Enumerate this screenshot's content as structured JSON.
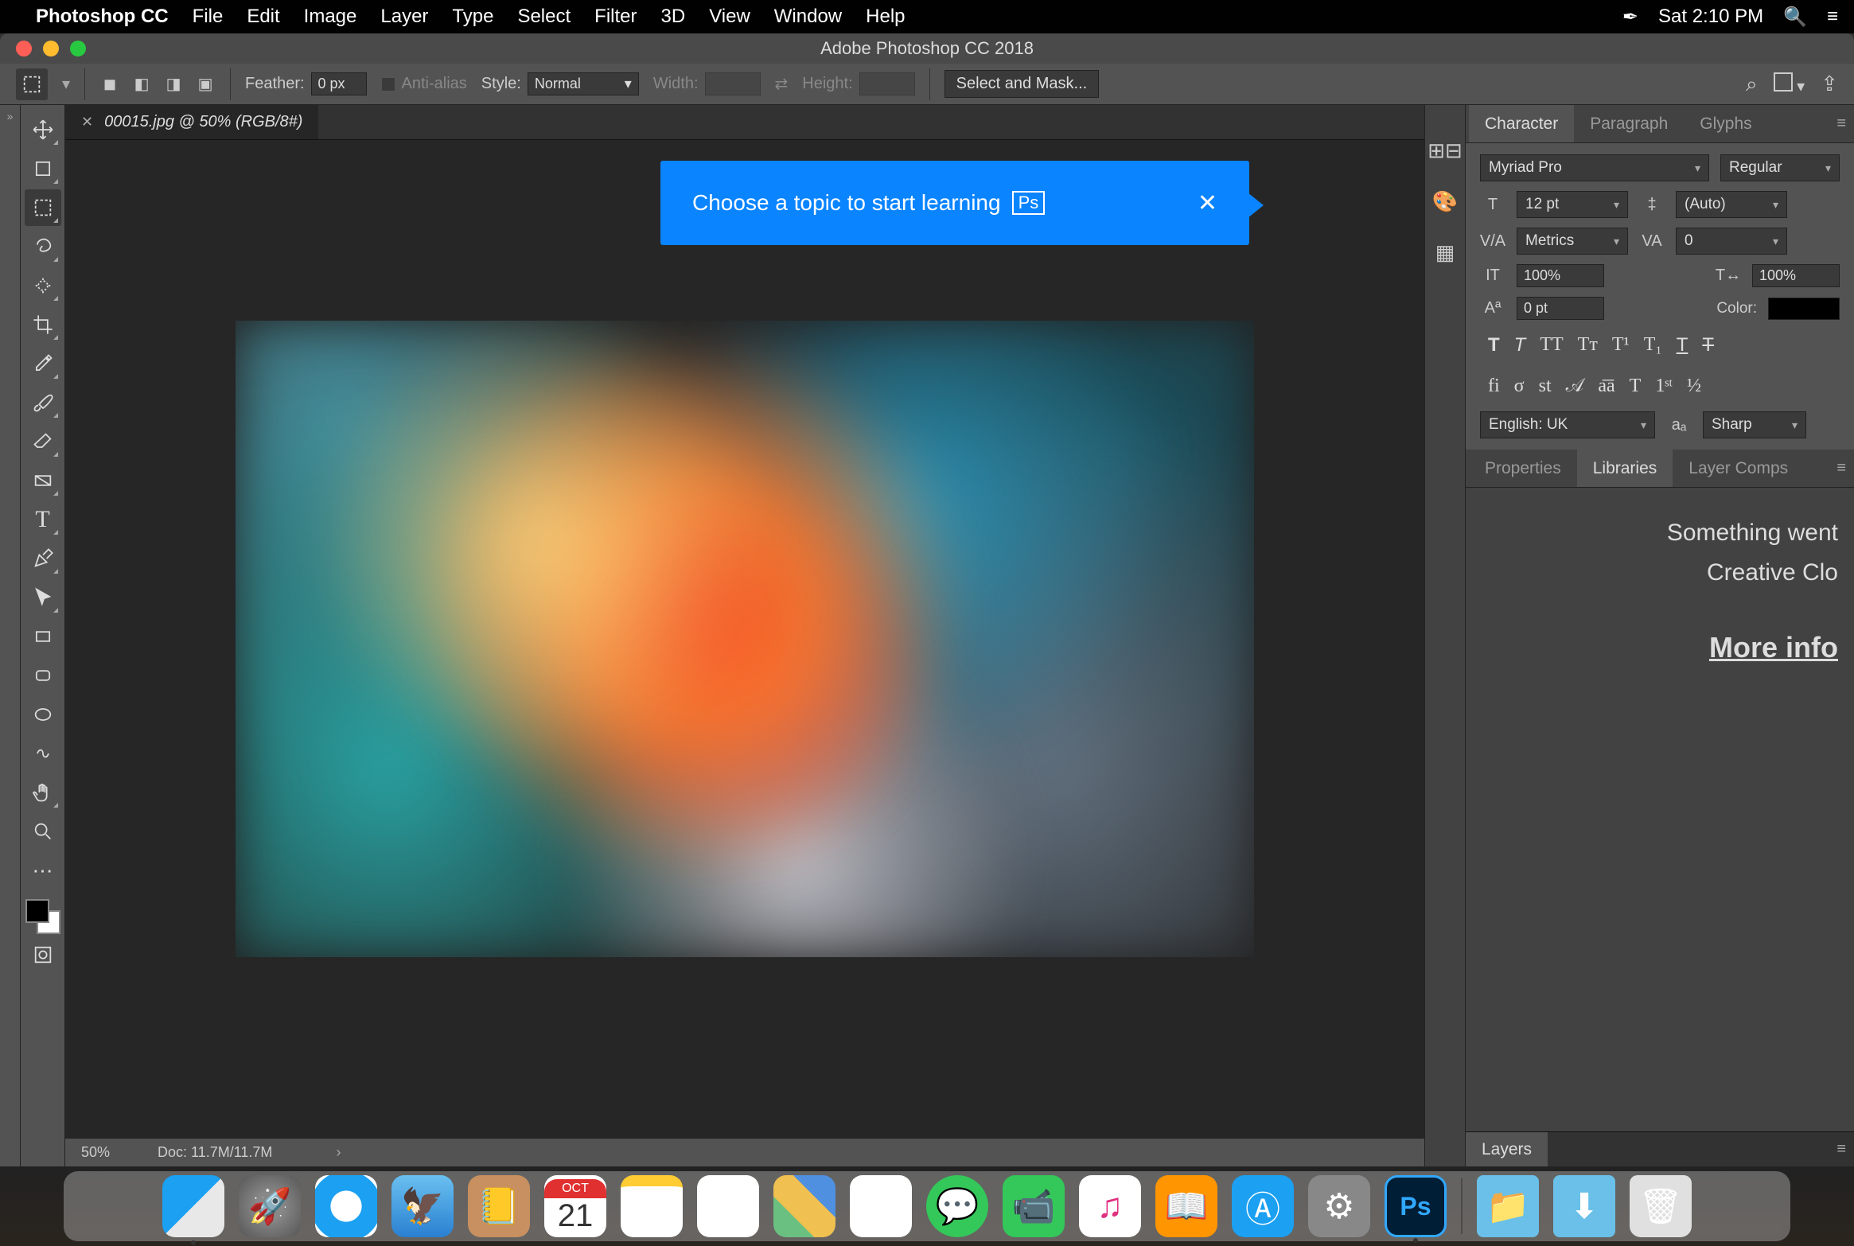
{
  "menubar": {
    "app": "Photoshop CC",
    "items": [
      "File",
      "Edit",
      "Image",
      "Layer",
      "Type",
      "Select",
      "Filter",
      "3D",
      "View",
      "Window",
      "Help"
    ],
    "clock": "Sat 2:10 PM"
  },
  "window": {
    "title": "Adobe Photoshop CC 2018"
  },
  "options": {
    "feather_label": "Feather:",
    "feather_value": "0 px",
    "antialias_label": "Anti-alias",
    "style_label": "Style:",
    "style_value": "Normal",
    "width_label": "Width:",
    "width_value": "",
    "height_label": "Height:",
    "height_value": "",
    "select_mask": "Select and Mask..."
  },
  "tab": {
    "label": "00015.jpg @ 50% (RGB/8#)"
  },
  "tooltip": {
    "text": "Choose a topic to start learning",
    "badge": "Ps"
  },
  "status": {
    "zoom": "50%",
    "doc": "Doc: 11.7M/11.7M"
  },
  "char_panel": {
    "tabs": [
      "Character",
      "Paragraph",
      "Glyphs"
    ],
    "font": "Myriad Pro",
    "weight": "Regular",
    "size": "12 pt",
    "leading": "(Auto)",
    "kerning": "Metrics",
    "tracking": "0",
    "vscale": "100%",
    "hscale": "100%",
    "baseline": "0 pt",
    "color_label": "Color:",
    "lang": "English: UK",
    "aa": "Sharp"
  },
  "lib_panel": {
    "tabs": [
      "Properties",
      "Libraries",
      "Layer Comps"
    ],
    "line1": "Something went",
    "line2": "Creative Clo",
    "more": "More info"
  },
  "layers": {
    "tab": "Layers"
  },
  "calendar": {
    "month": "OCT",
    "day": "21"
  }
}
